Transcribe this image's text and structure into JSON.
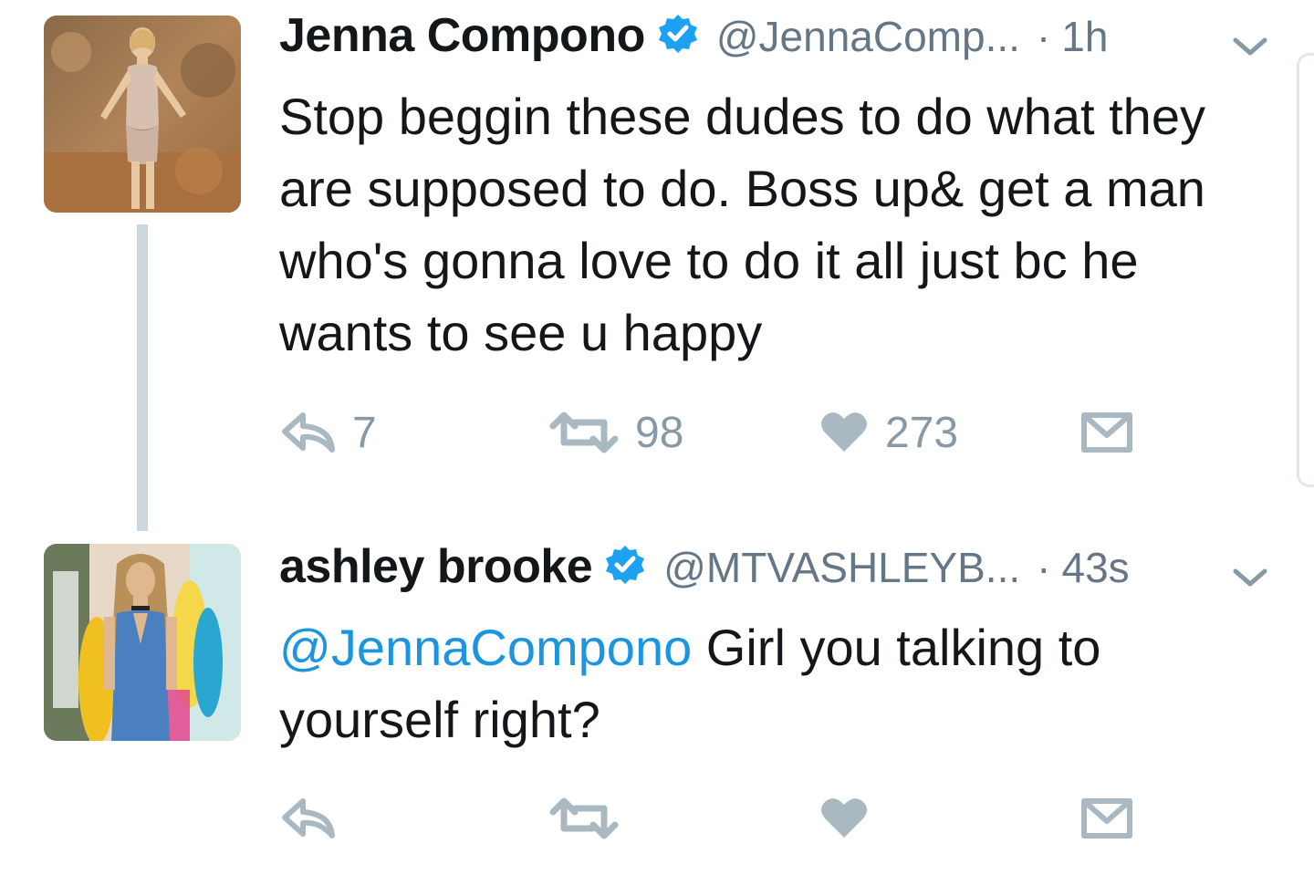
{
  "tweets": [
    {
      "name": "Jenna Compono",
      "handle": "@JennaComp...",
      "separator": "·",
      "time": "1h",
      "text": "Stop beggin these dudes to do what they are supposed to do. Boss up& get a man who's gonna love to do it all just bc he wants to see u happy",
      "replies": "7",
      "retweets": "98",
      "likes": "273"
    },
    {
      "name": "ashley brooke",
      "handle": "@MTVASHLEYB...",
      "separator": "·",
      "time": "43s",
      "mention": "@JennaCompono",
      "text": " Girl you talking to yourself right?",
      "replies": "",
      "retweets": "",
      "likes": ""
    }
  ],
  "icons": {
    "verified": "verified-badge-icon",
    "chevron": "chevron-down-icon",
    "reply": "reply-icon",
    "retweet": "retweet-icon",
    "like": "heart-icon",
    "dm": "envelope-icon"
  },
  "colors": {
    "verified": "#1da1f2",
    "mention": "#1b95e0",
    "action": "#aab8c2",
    "muted": "#657786",
    "thread_line": "#ccd6dd"
  }
}
